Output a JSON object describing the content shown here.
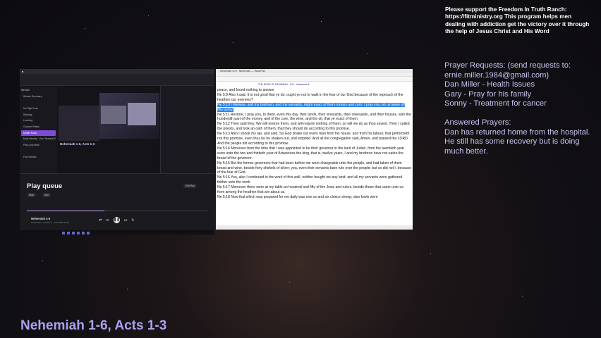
{
  "support_text": "Please support the Freedom In Truth Ranch: https://fitministry.org This program helps men dealing with addiction get the victory over it through the help of Jesus Christ and His Word",
  "prayer": {
    "requests_header": "Prayer Requests: (send requests to: ernie.miller.1984@gmail.com)",
    "requests": [
      "Dan Miller - Health Issues",
      "Gary - Pray for his family",
      "Sonny - Treatment for cancer"
    ],
    "answered_header": "Answered Prayers:",
    "answered_text": "Dan has returned home from the hospital. He still has some recovery but is doing much better."
  },
  "reading_title": "Nehemiah 1-6, Acts 1-3",
  "stream_window": {
    "preview_caption": "Nehemiah 1-6, Acts 1-3",
    "nav": {
      "header": "Stream",
      "items": [
        "Stream Summary",
        "",
        "No Right Now",
        "Ranking",
        "Learning",
        "Channel Plants",
        "Mobile Music",
        "Mute Nearby · Your Terminal 5",
        "Play Only Mark",
        "",
        "Find Stream"
      ],
      "active_index": 6
    },
    "play_queue": {
      "title": "Play queue",
      "btn_1": "Mute",
      "btn_2": "Add",
      "btn_3": "Edit Play",
      "progress": 0.43,
      "now_playing_title": "Nehemiah 4-5",
      "now_playing_sub": "Nehemiah 4 Chapter 1 · The Bible (KJV)"
    }
  },
  "bible_window": {
    "title": "Nehemiah 5.rtf - Nehemiah — WordPad",
    "subheader": "THE BOOK OF NEHEMIAH · KJV · Nehemiah 5",
    "highlight_color": "#2f86e6",
    "lines": [
      {
        "text": "peace, and found nothing to answer",
        "hl": false
      },
      {
        "text": "Ne 5:9  Also I said, It is not good that ye do: ought ye not to walk in the fear of our God because of the reproach of the heathen our enemies?",
        "hl": false
      },
      {
        "text": "Ne 5:10  I likewise, and my brethren, and my servants, might exact of them money and corn: I pray you, let us leave off this usury.",
        "hl": true
      },
      {
        "text": "Ne 5:11  Restore, I pray you, to them, even this day, their lands, their vineyards, their oliveyards, and their houses, also the hundredth part of the money, and of the corn, the wine, and the oil, that ye exact of them.",
        "hl": false
      },
      {
        "text": "Ne 5:12  Then said they, We will restore them, and will require nothing of them; so will we do as thou sayest. Then I called the priests, and took an oath of them, that they should do according to this promise.",
        "hl": false
      },
      {
        "text": "Ne 5:13  Also I shook my lap, and said, So God shake out every man from his house, and from his labour, that performeth not this promise, even thus be he shaken out, and emptied. And all the congregation said, Amen, and praised the LORD. And the people did according to this promise.",
        "hl": false
      },
      {
        "text": "Ne 5:14  Moreover from the time that I was appointed to be their governor in the land of Judah, from the twentieth year even unto the two and thirtieth year of Artaxerxes the king, that is, twelve years, I and my brethren have not eaten the bread of the governor.",
        "hl": false
      },
      {
        "text": "Ne 5:15  But the former governors that had been before me were chargeable unto the people, and had taken of them bread and wine, beside forty shekels of silver; yea, even their servants bare rule over the people: but so did not I, because of the fear of God.",
        "hl": false
      },
      {
        "text": "Ne 5:16  Yea, also I continued in the work of this wall, neither bought we any land: and all my servants were gathered thither unto the work.",
        "hl": false
      },
      {
        "text": "Ne 5:17  Moreover there were at my table an hundred and fifty of the Jews and rulers, beside those that came unto us from among the heathen that are about us.",
        "hl": false
      },
      {
        "text": "Ne 5:18  Now that which was prepared for me daily was one ox and six choice sheep; also fowls were",
        "hl": false
      }
    ]
  }
}
